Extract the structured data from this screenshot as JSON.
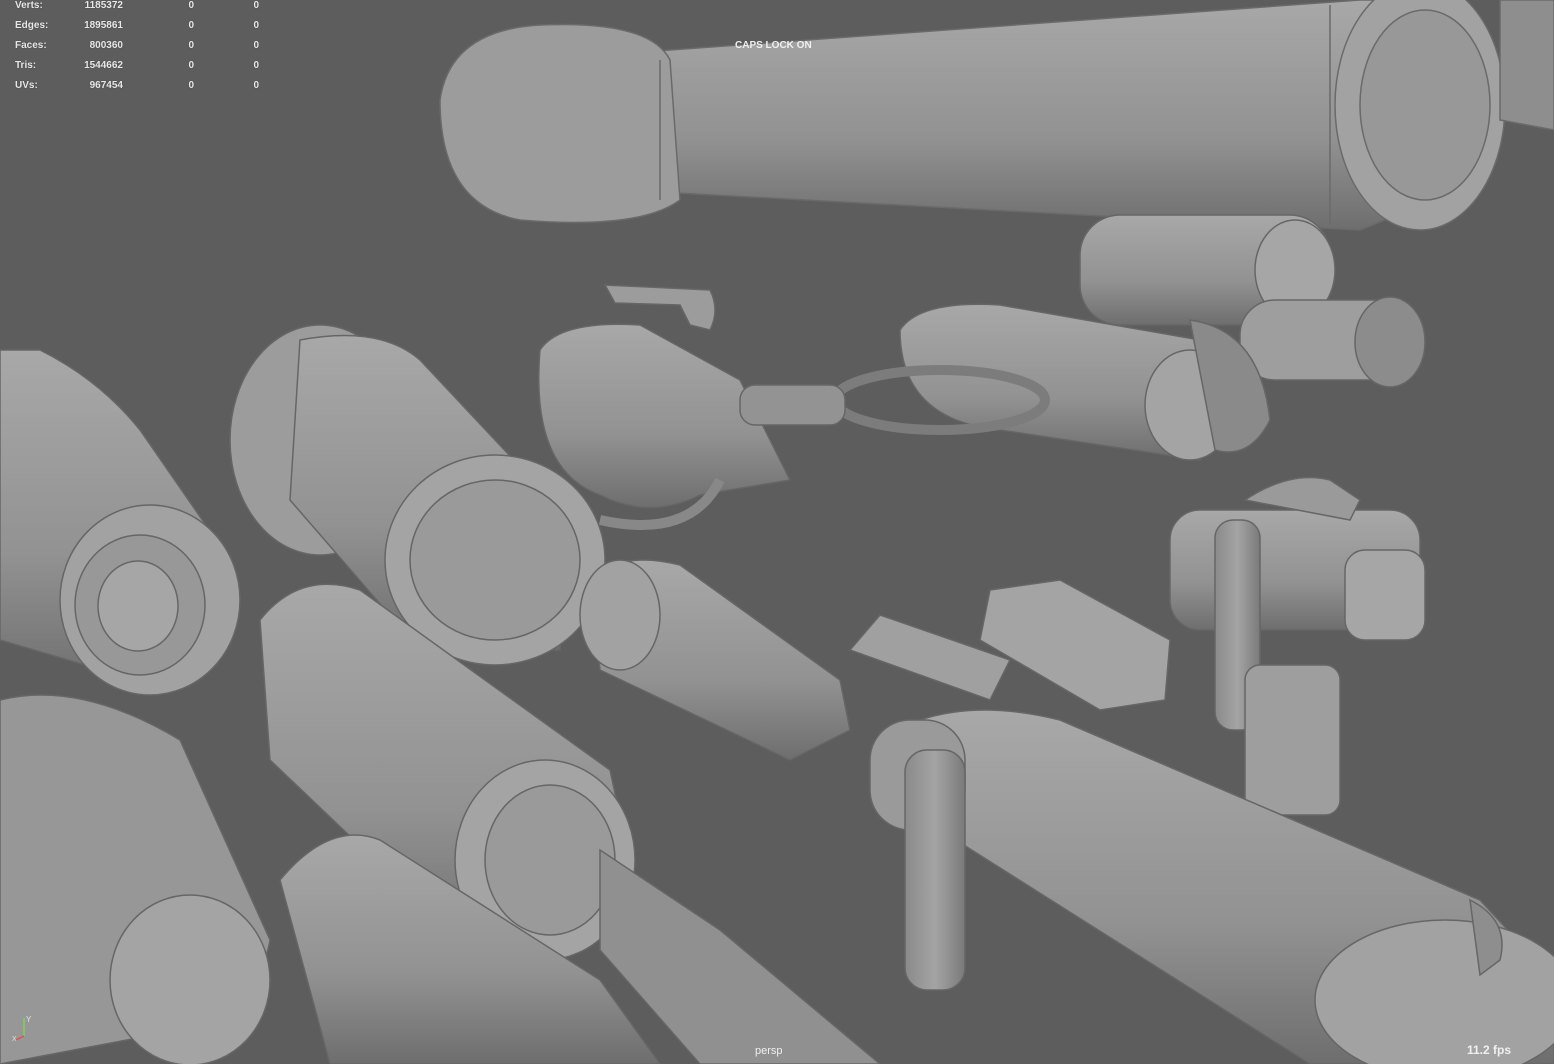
{
  "stats": [
    {
      "label": "Verts:",
      "v1": "1185372",
      "v2": "0",
      "v3": "0"
    },
    {
      "label": "Edges:",
      "v1": "1895861",
      "v2": "0",
      "v3": "0"
    },
    {
      "label": "Faces:",
      "v1": "800360",
      "v2": "0",
      "v3": "0"
    },
    {
      "label": "Tris:",
      "v1": "1544662",
      "v2": "0",
      "v3": "0"
    },
    {
      "label": "UVs:",
      "v1": "967454",
      "v2": "0",
      "v3": "0"
    }
  ],
  "caps_lock": "CAPS LOCK ON",
  "camera": "persp",
  "fps": "11.2 fps",
  "axis": {
    "y": "Y",
    "x": "X",
    "y_color": "#7fd15a",
    "x_color": "#e05050"
  },
  "colors": {
    "viewport_bg": "#5d5d5d",
    "mesh": "#9a9a9a",
    "hud_text": "#e8e8e8"
  }
}
